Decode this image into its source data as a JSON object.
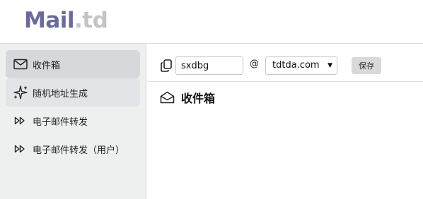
{
  "header": {
    "logo_main": "Mail",
    "logo_suffix": ".td"
  },
  "sidebar": {
    "items": [
      {
        "label": "收件箱",
        "icon": "mail-icon",
        "active": true
      },
      {
        "label": "随机地址生成",
        "icon": "sparkle-icon",
        "active": false
      },
      {
        "label": "电子邮件转发",
        "icon": "forward-icon",
        "active": false
      },
      {
        "label": "电子邮件转发（用户）",
        "icon": "forward-icon",
        "active": false
      }
    ]
  },
  "toolbar": {
    "username_value": "sxdbg",
    "at_symbol": "@",
    "domain_selected": "tdtda.com",
    "save_label": "保存"
  },
  "main": {
    "title": "收件箱",
    "title_icon": "envelope-open-icon"
  }
}
